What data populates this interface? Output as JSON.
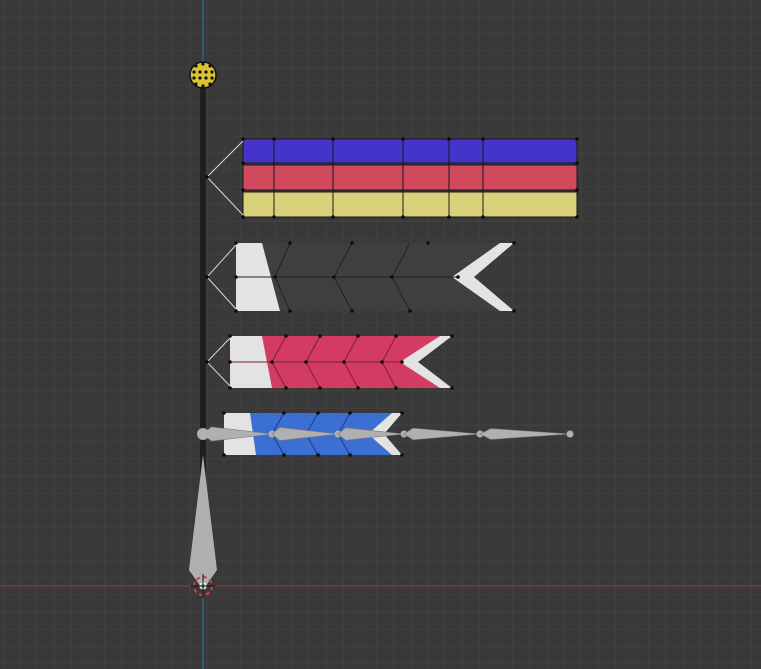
{
  "viewport": {
    "background": "#393939",
    "grid_minor_color": "#414141",
    "grid_major_color": "#4a4a4a",
    "axis_x_color": "#8a3f49",
    "axis_z_color": "#2f6c99"
  },
  "objects": {
    "pole": {
      "color": "#1f1f1f"
    },
    "pole_top_ball": {
      "color": "#d9c233"
    },
    "streamer": {
      "stripe_colors": [
        "#4534c9",
        "#d2495e",
        "#d9d07a"
      ]
    },
    "koi_black": {
      "body_color": "#3f3f3f",
      "tail_color": "#e3e3e3"
    },
    "koi_red": {
      "body_color": "#d33b63",
      "tail_color": "#e3e3e3"
    },
    "koi_blue": {
      "body_color": "#3c6fd2",
      "tail_color": "#e3e3e3"
    },
    "armature": {
      "bone_color": "#b0b0b0"
    },
    "origin_cursor": {
      "ring_color": "#d04040"
    }
  }
}
